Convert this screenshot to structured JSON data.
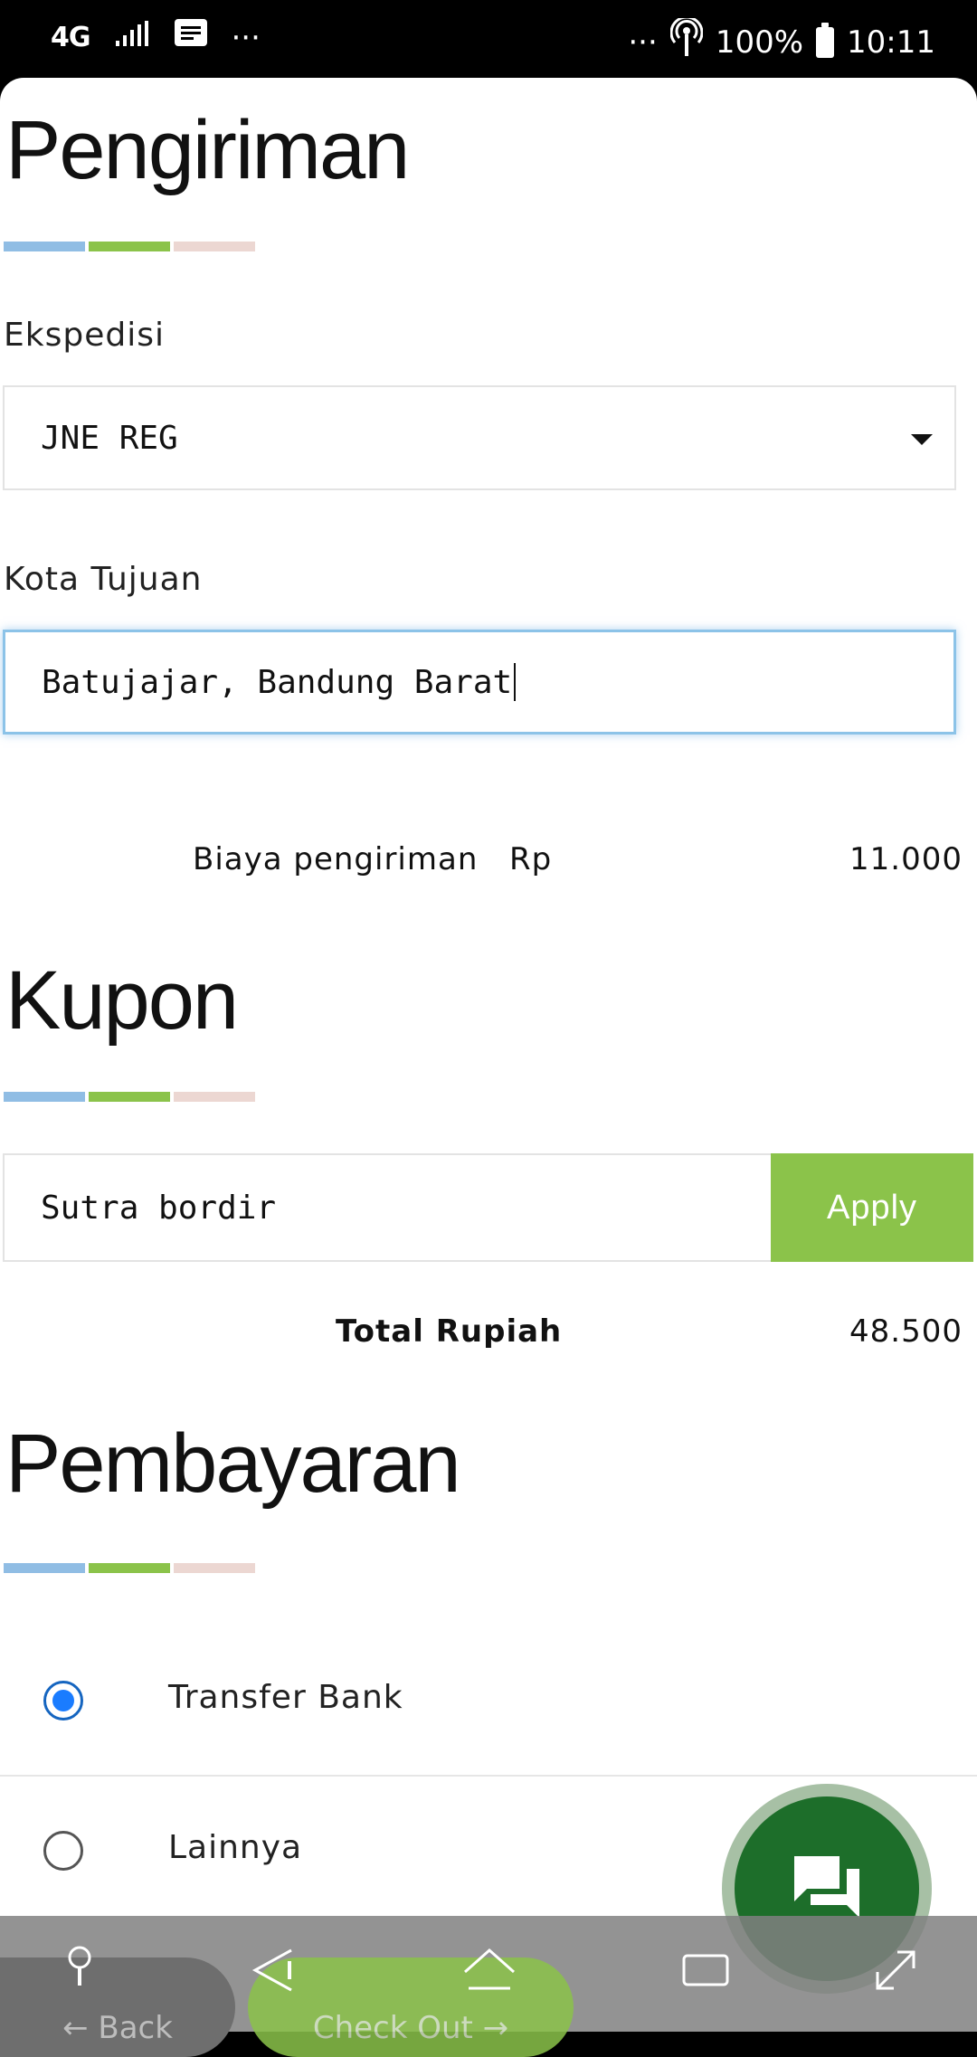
{
  "status_bar": {
    "network": "4G",
    "overflow_left": "···",
    "overflow_right": "···",
    "battery": "100%",
    "time": "10:11"
  },
  "shipping": {
    "title": "Pengiriman",
    "courier_label": "Ekspedisi",
    "courier_value": "JNE REG",
    "city_label": "Kota Tujuan",
    "city_value": "Batujajar, Bandung Barat",
    "cost_label": "Biaya pengiriman",
    "cost_currency": "Rp",
    "cost_value": "11.000"
  },
  "coupon": {
    "title": "Kupon",
    "value": "Sutra bordir",
    "apply_label": "Apply",
    "total_label": "Total Rupiah",
    "total_value": "48.500"
  },
  "payment": {
    "title": "Pembayaran",
    "options": [
      {
        "label": "Transfer Bank",
        "selected": true
      },
      {
        "label": "Lainnya",
        "selected": false
      }
    ]
  },
  "bottom_bar": {
    "back_label": "← Back",
    "checkout_label": "Check Out →"
  },
  "colors": {
    "accent_blue": "#90bde4",
    "accent_green": "#8bc34a",
    "accent_pink": "#ecd7d2",
    "fab_green": "#1d6e2a"
  },
  "icons": [
    "signal-icon",
    "message-icon",
    "hotspot-icon",
    "battery-icon",
    "chat-icon",
    "pin-icon",
    "back-nav-icon",
    "home-nav-icon",
    "recents-nav-icon",
    "expand-icon"
  ]
}
